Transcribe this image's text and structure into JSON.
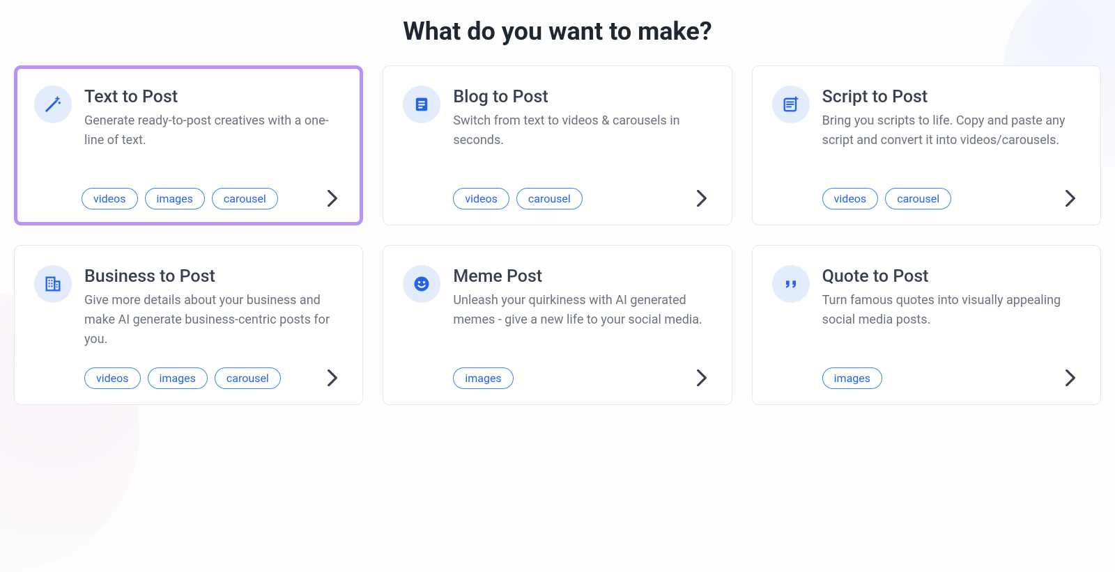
{
  "title": "What do you want to make?",
  "cards": [
    {
      "title": "Text to Post",
      "desc": "Generate ready-to-post creatives with a one-line of text.",
      "tags": [
        "videos",
        "images",
        "carousel"
      ],
      "icon": "magic-wand-icon",
      "selected": true
    },
    {
      "title": "Blog to Post",
      "desc": "Switch from text to videos & carousels in seconds.",
      "tags": [
        "videos",
        "carousel"
      ],
      "icon": "document-icon",
      "selected": false
    },
    {
      "title": "Script to Post",
      "desc": "Bring you scripts to life. Copy and paste any script and convert it into videos/carousels.",
      "tags": [
        "videos",
        "carousel"
      ],
      "icon": "script-icon",
      "selected": false
    },
    {
      "title": "Business to Post",
      "desc": "Give more details about your business and make AI generate business-centric posts for you.",
      "tags": [
        "videos",
        "images",
        "carousel"
      ],
      "icon": "building-icon",
      "selected": false
    },
    {
      "title": "Meme Post",
      "desc": "Unleash your quirkiness with AI generated memes - give a new life to your social media.",
      "tags": [
        "images"
      ],
      "icon": "smile-icon",
      "selected": false
    },
    {
      "title": "Quote to Post",
      "desc": "Turn famous quotes into visually appealing social media posts.",
      "tags": [
        "images"
      ],
      "icon": "quote-icon",
      "selected": false
    }
  ]
}
